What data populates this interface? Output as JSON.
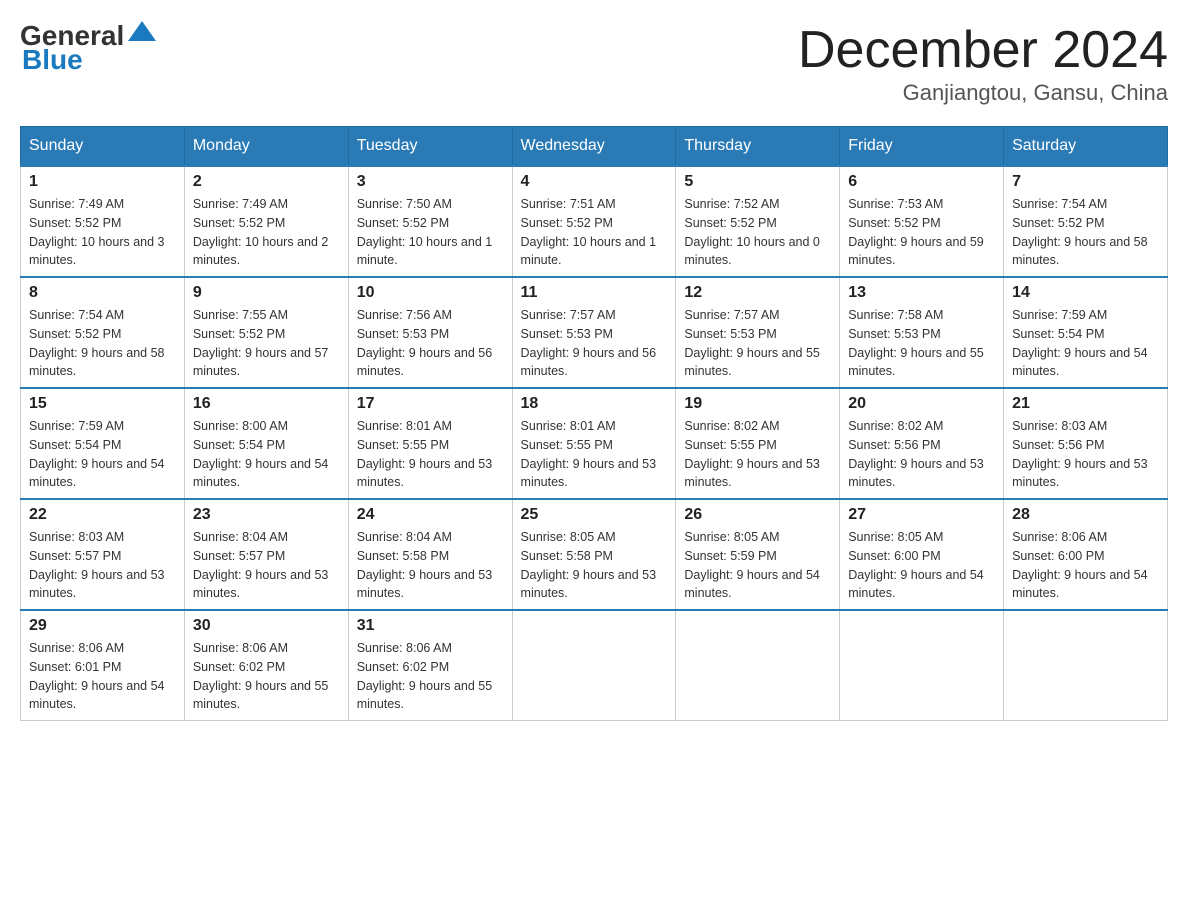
{
  "header": {
    "logo_general": "General",
    "logo_blue": "Blue",
    "month_title": "December 2024",
    "location": "Ganjiangtou, Gansu, China"
  },
  "weekdays": [
    "Sunday",
    "Monday",
    "Tuesday",
    "Wednesday",
    "Thursday",
    "Friday",
    "Saturday"
  ],
  "weeks": [
    [
      {
        "day": "1",
        "sunrise": "7:49 AM",
        "sunset": "5:52 PM",
        "daylight": "10 hours and 3 minutes."
      },
      {
        "day": "2",
        "sunrise": "7:49 AM",
        "sunset": "5:52 PM",
        "daylight": "10 hours and 2 minutes."
      },
      {
        "day": "3",
        "sunrise": "7:50 AM",
        "sunset": "5:52 PM",
        "daylight": "10 hours and 1 minute."
      },
      {
        "day": "4",
        "sunrise": "7:51 AM",
        "sunset": "5:52 PM",
        "daylight": "10 hours and 1 minute."
      },
      {
        "day": "5",
        "sunrise": "7:52 AM",
        "sunset": "5:52 PM",
        "daylight": "10 hours and 0 minutes."
      },
      {
        "day": "6",
        "sunrise": "7:53 AM",
        "sunset": "5:52 PM",
        "daylight": "9 hours and 59 minutes."
      },
      {
        "day": "7",
        "sunrise": "7:54 AM",
        "sunset": "5:52 PM",
        "daylight": "9 hours and 58 minutes."
      }
    ],
    [
      {
        "day": "8",
        "sunrise": "7:54 AM",
        "sunset": "5:52 PM",
        "daylight": "9 hours and 58 minutes."
      },
      {
        "day": "9",
        "sunrise": "7:55 AM",
        "sunset": "5:52 PM",
        "daylight": "9 hours and 57 minutes."
      },
      {
        "day": "10",
        "sunrise": "7:56 AM",
        "sunset": "5:53 PM",
        "daylight": "9 hours and 56 minutes."
      },
      {
        "day": "11",
        "sunrise": "7:57 AM",
        "sunset": "5:53 PM",
        "daylight": "9 hours and 56 minutes."
      },
      {
        "day": "12",
        "sunrise": "7:57 AM",
        "sunset": "5:53 PM",
        "daylight": "9 hours and 55 minutes."
      },
      {
        "day": "13",
        "sunrise": "7:58 AM",
        "sunset": "5:53 PM",
        "daylight": "9 hours and 55 minutes."
      },
      {
        "day": "14",
        "sunrise": "7:59 AM",
        "sunset": "5:54 PM",
        "daylight": "9 hours and 54 minutes."
      }
    ],
    [
      {
        "day": "15",
        "sunrise": "7:59 AM",
        "sunset": "5:54 PM",
        "daylight": "9 hours and 54 minutes."
      },
      {
        "day": "16",
        "sunrise": "8:00 AM",
        "sunset": "5:54 PM",
        "daylight": "9 hours and 54 minutes."
      },
      {
        "day": "17",
        "sunrise": "8:01 AM",
        "sunset": "5:55 PM",
        "daylight": "9 hours and 53 minutes."
      },
      {
        "day": "18",
        "sunrise": "8:01 AM",
        "sunset": "5:55 PM",
        "daylight": "9 hours and 53 minutes."
      },
      {
        "day": "19",
        "sunrise": "8:02 AM",
        "sunset": "5:55 PM",
        "daylight": "9 hours and 53 minutes."
      },
      {
        "day": "20",
        "sunrise": "8:02 AM",
        "sunset": "5:56 PM",
        "daylight": "9 hours and 53 minutes."
      },
      {
        "day": "21",
        "sunrise": "8:03 AM",
        "sunset": "5:56 PM",
        "daylight": "9 hours and 53 minutes."
      }
    ],
    [
      {
        "day": "22",
        "sunrise": "8:03 AM",
        "sunset": "5:57 PM",
        "daylight": "9 hours and 53 minutes."
      },
      {
        "day": "23",
        "sunrise": "8:04 AM",
        "sunset": "5:57 PM",
        "daylight": "9 hours and 53 minutes."
      },
      {
        "day": "24",
        "sunrise": "8:04 AM",
        "sunset": "5:58 PM",
        "daylight": "9 hours and 53 minutes."
      },
      {
        "day": "25",
        "sunrise": "8:05 AM",
        "sunset": "5:58 PM",
        "daylight": "9 hours and 53 minutes."
      },
      {
        "day": "26",
        "sunrise": "8:05 AM",
        "sunset": "5:59 PM",
        "daylight": "9 hours and 54 minutes."
      },
      {
        "day": "27",
        "sunrise": "8:05 AM",
        "sunset": "6:00 PM",
        "daylight": "9 hours and 54 minutes."
      },
      {
        "day": "28",
        "sunrise": "8:06 AM",
        "sunset": "6:00 PM",
        "daylight": "9 hours and 54 minutes."
      }
    ],
    [
      {
        "day": "29",
        "sunrise": "8:06 AM",
        "sunset": "6:01 PM",
        "daylight": "9 hours and 54 minutes."
      },
      {
        "day": "30",
        "sunrise": "8:06 AM",
        "sunset": "6:02 PM",
        "daylight": "9 hours and 55 minutes."
      },
      {
        "day": "31",
        "sunrise": "8:06 AM",
        "sunset": "6:02 PM",
        "daylight": "9 hours and 55 minutes."
      },
      null,
      null,
      null,
      null
    ]
  ],
  "labels": {
    "sunrise_prefix": "Sunrise: ",
    "sunset_prefix": "Sunset: ",
    "daylight_prefix": "Daylight: "
  }
}
